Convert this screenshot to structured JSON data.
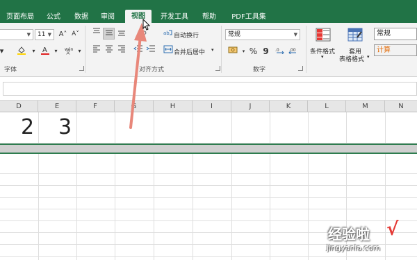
{
  "tabs": [
    "页面布局",
    "公式",
    "数据",
    "审阅",
    "视图",
    "开发工具",
    "帮助",
    "PDF工具集"
  ],
  "active_tab": "视图",
  "font_group": {
    "font_size": "11",
    "grow_glyph": "A˄",
    "shrink_glyph": "A˅",
    "label": "字体"
  },
  "align_group": {
    "wrap_text": "自动换行",
    "merge_center": "合并后居中",
    "label": "对齐方式"
  },
  "number_group": {
    "format": "常规",
    "percent": "%",
    "comma": "9",
    "label": "数字"
  },
  "styles_group": {
    "conditional_format": "条件格式",
    "table_format_line1": "套用",
    "table_format_line2": "表格格式",
    "style_normal": "常规",
    "style_calc": "计算"
  },
  "columns": [
    "D",
    "E",
    "F",
    "G",
    "H",
    "I",
    "J",
    "K",
    "L",
    "M",
    "N"
  ],
  "cells": {
    "d1": "2",
    "e1": "3"
  },
  "watermark": {
    "title": "经验啦",
    "check": "√",
    "url": "jingyanla.com"
  },
  "colors": {
    "accent": "#217346",
    "arrow": "#e8877a",
    "calc_style": "#e36c09"
  }
}
